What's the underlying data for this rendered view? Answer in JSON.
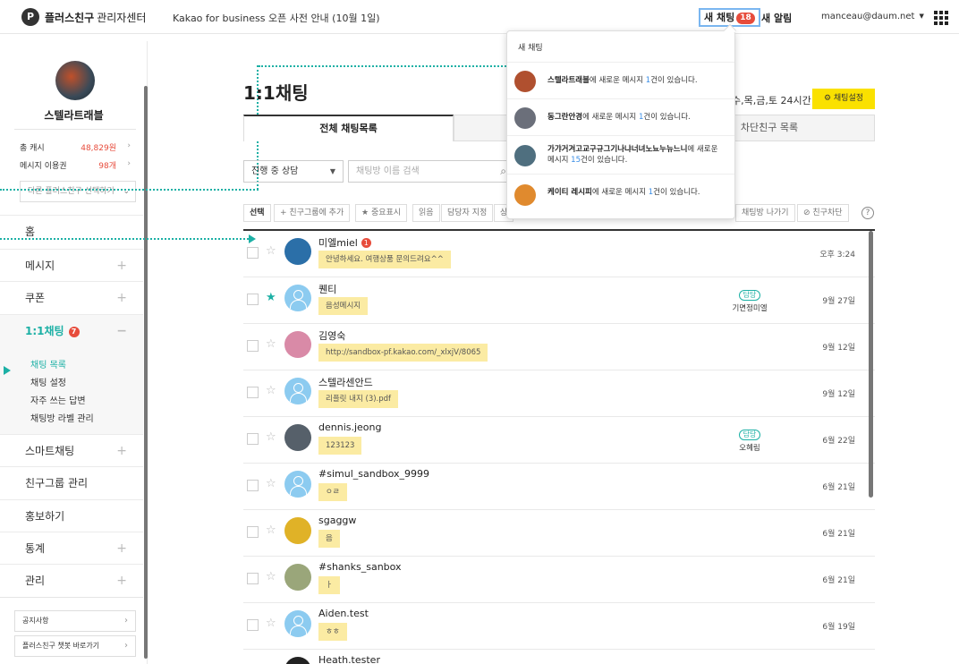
{
  "topbar": {
    "logo_glyph": "P",
    "brand": "플러스친구",
    "brand_sub": "관리자센터",
    "notice": "Kakao for business 오픈 사전 안내 (10월 1일)",
    "new_chat_label": "새 채팅",
    "new_chat_count": "18",
    "new_alert_label": "새 알림",
    "email": "manceau@daum.net"
  },
  "sidebar": {
    "profile_name": "스텔라트래블",
    "stats": [
      {
        "label": "총 캐시",
        "value": "48,829원"
      },
      {
        "label": "메시지 이용권",
        "value": "98개"
      }
    ],
    "select_placeholder": "다른 플러스친구 선택하기",
    "menu": {
      "home": "홈",
      "message": "메시지",
      "coupon": "쿠폰",
      "chat": "1:1채팅",
      "chat_badge": "7",
      "smart_chat": "스마트채팅",
      "friend_group": "친구그룹 관리",
      "promote": "홍보하기",
      "stats": "통계",
      "manage": "관리"
    },
    "submenu": [
      "채팅 목록",
      "채팅 설정",
      "자주 쓰는 답변",
      "채팅방 라벨 관리"
    ],
    "footer": [
      "공지사항",
      "플러스친구 챗봇 바로가기"
    ]
  },
  "main": {
    "title": "1:1채팅",
    "hours": "수,목,금,토 24시간",
    "setting_button": "채팅설정",
    "tabs": [
      "전체 채팅목록",
      "",
      "차단친구 목록"
    ],
    "filter_dropdown": "진행 중 상담",
    "search_placeholder": "채팅방 이름 검색",
    "toolbar": {
      "select": "선택",
      "add_group": "친구그룹에 추가",
      "mark": "중요표시",
      "read": "읽음",
      "assign": "담당자 지정",
      "status": "상",
      "leave": "채팅방 나가기",
      "block": "친구차단",
      "help": "?"
    }
  },
  "chats": [
    {
      "name": "미엘miel",
      "unread": "1",
      "msg": "안녕하세요. 여행상품 문의드려요^^",
      "time": "오후 3:24",
      "starred": false,
      "assigned": false,
      "assignee": "",
      "avatar_color": "#2b6fa8"
    },
    {
      "name": "퀜티",
      "unread": "",
      "msg": "음성메시지",
      "time": "9월 27일",
      "starred": true,
      "assigned": true,
      "assignee": "기면정미엘",
      "avatar_color": ""
    },
    {
      "name": "김영숙",
      "unread": "",
      "msg": "http://sandbox-pf.kakao.com/_xlxjV/8065",
      "time": "9월 12일",
      "starred": false,
      "assigned": false,
      "assignee": "",
      "avatar_color": "#d98aa7"
    },
    {
      "name": "스텔라센안드",
      "unread": "",
      "msg": "리플릿 내지 (3).pdf",
      "time": "9월 12일",
      "starred": false,
      "assigned": false,
      "assignee": "",
      "avatar_color": ""
    },
    {
      "name": "dennis.jeong",
      "unread": "",
      "msg": "123123",
      "time": "6월 22일",
      "starred": false,
      "assigned": true,
      "assignee": "오혜림",
      "avatar_color": "#56606a"
    },
    {
      "name": "#simul_sandbox_9999",
      "unread": "",
      "msg": "ㅇㄹ",
      "time": "6월 21일",
      "starred": false,
      "assigned": false,
      "assignee": "",
      "avatar_color": ""
    },
    {
      "name": "sgaggw",
      "unread": "",
      "msg": "음",
      "time": "6월 21일",
      "starred": false,
      "assigned": false,
      "assignee": "",
      "avatar_color": "#e0b227"
    },
    {
      "name": "#shanks_sanbox",
      "unread": "",
      "msg": "ㅏ",
      "time": "6월 21일",
      "starred": false,
      "assigned": false,
      "assignee": "",
      "avatar_color": "#9aa67a"
    },
    {
      "name": "Aiden.test",
      "unread": "",
      "msg": "ㅎㅎ",
      "time": "6월 19일",
      "starred": false,
      "assigned": false,
      "assignee": "",
      "avatar_color": ""
    },
    {
      "name": "Heath.tester",
      "unread": "",
      "msg": "",
      "time": "",
      "starred": false,
      "assigned": false,
      "assignee": "",
      "avatar_color": "#222222"
    }
  ],
  "assign_label": "담당",
  "popup": {
    "header": "새 채팅",
    "items": [
      {
        "name": "스텔라트래블",
        "pre": "에 새로운 메시지 ",
        "count": "1",
        "post": "건이 있습니다.",
        "avatar_color": "#b0502f"
      },
      {
        "name": "동그란안경",
        "pre": "에 새로운 메시지 ",
        "count": "1",
        "post": "건이 있습니다.",
        "avatar_color": "#6b6f7a"
      },
      {
        "name": "가갸거겨고교구규그기나냐너녀노뇨누뉴느니",
        "pre": "에 새로운 메시지 ",
        "count": "15",
        "post": "건이 있습니다.",
        "avatar_color": "#4f6f7f"
      },
      {
        "name": "케이티 레시피",
        "pre": "에 새로운 메시지 ",
        "count": "1",
        "post": "건이 있습니다.",
        "avatar_color": "#e08a2e"
      }
    ]
  },
  "colors": {
    "accent": "#1cb0a5",
    "alert": "#e74c3c",
    "yellow": "#fae100",
    "bubble": "#fbeba3"
  }
}
